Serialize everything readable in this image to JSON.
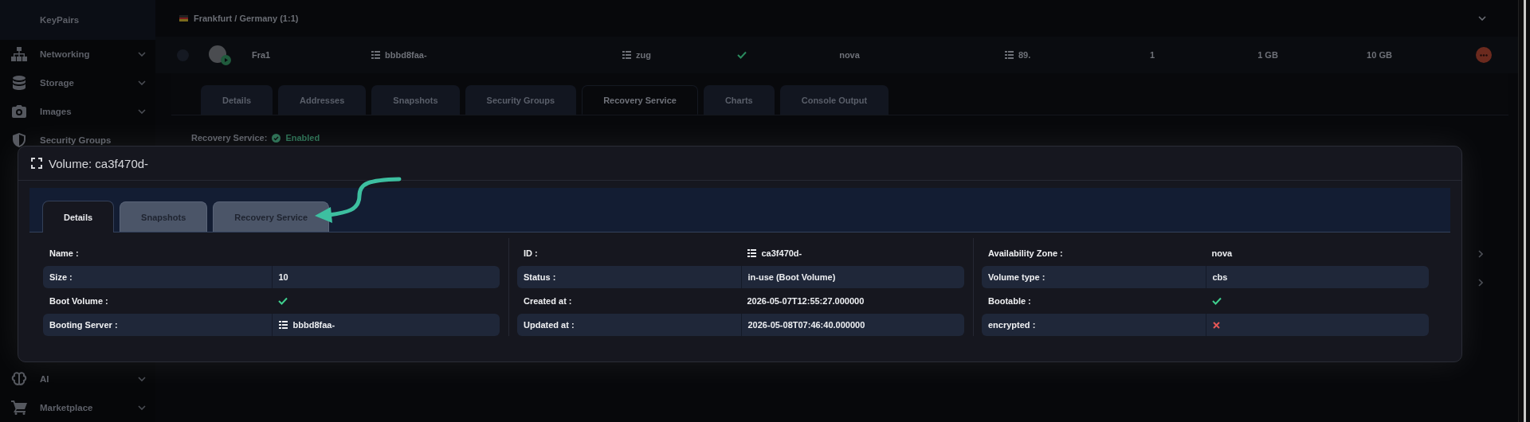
{
  "sidebar": {
    "items": [
      {
        "label": "KeyPairs",
        "kind": "subitem",
        "expandable": false
      },
      {
        "label": "Networking",
        "kind": "section",
        "expandable": true
      },
      {
        "label": "Storage",
        "kind": "section",
        "expandable": true
      },
      {
        "label": "Images",
        "kind": "section",
        "expandable": true
      },
      {
        "label": "Security Groups",
        "kind": "section",
        "expandable": false
      },
      {
        "label": "AI",
        "kind": "section",
        "expandable": true
      },
      {
        "label": "Marketplace",
        "kind": "section",
        "expandable": true
      }
    ]
  },
  "region": {
    "label": "Frankfurt / Germany (1:1)"
  },
  "server_row": {
    "selected": false,
    "cells": [
      {
        "kind": "text",
        "text": "Fra1"
      },
      {
        "kind": "id",
        "text": "bbbd8faa-"
      },
      {
        "kind": "id",
        "text": "zug"
      },
      {
        "kind": "bool",
        "checked": true
      },
      {
        "kind": "text",
        "text": "nova"
      },
      {
        "kind": "id",
        "text": "89."
      },
      {
        "kind": "text",
        "text": "1"
      },
      {
        "kind": "text",
        "text": "1 GB"
      },
      {
        "kind": "text",
        "text": "10 GB"
      }
    ]
  },
  "server_tabs": [
    {
      "label": "Details",
      "selected": false
    },
    {
      "label": "Addresses",
      "selected": false
    },
    {
      "label": "Snapshots",
      "selected": false
    },
    {
      "label": "Security Groups",
      "selected": false
    },
    {
      "label": "Recovery Service",
      "selected": true
    },
    {
      "label": "Charts",
      "selected": false
    },
    {
      "label": "Console Output",
      "selected": false
    }
  ],
  "recovery_service": {
    "label": "Recovery Service:",
    "status": "Enabled",
    "enabled": true
  },
  "modal": {
    "title": "Volume: ca3f470d-",
    "tabs": [
      {
        "label": "Details",
        "selected": true
      },
      {
        "label": "Snapshots",
        "selected": false
      },
      {
        "label": "Recovery Service",
        "selected": false
      }
    ],
    "columns": [
      [
        {
          "label": "Name :",
          "kind": "text"
        },
        {
          "label": "Size :",
          "kind": "text",
          "value": "10"
        },
        {
          "label": "Boot Volume :",
          "kind": "bool",
          "checked": true
        },
        {
          "label": "Booting Server :",
          "kind": "id",
          "value": "bbbd8faa-"
        }
      ],
      [
        {
          "label": "ID :",
          "kind": "id",
          "value": "ca3f470d-"
        },
        {
          "label": "Status :",
          "kind": "text",
          "value": "in-use (Boot Volume)"
        },
        {
          "label": "Created at :",
          "kind": "text",
          "value": "2026-05-07T12:55:27.000000"
        },
        {
          "label": "Updated at :",
          "kind": "text",
          "value": "2026-05-08T07:46:40.000000"
        }
      ],
      [
        {
          "label": "Availability Zone :",
          "kind": "text",
          "value": "nova"
        },
        {
          "label": "Volume type :",
          "kind": "text",
          "value": "cbs"
        },
        {
          "label": "Bootable :",
          "kind": "bool",
          "checked": true
        },
        {
          "label": "encrypted :",
          "kind": "bool",
          "checked": false
        }
      ]
    ]
  }
}
